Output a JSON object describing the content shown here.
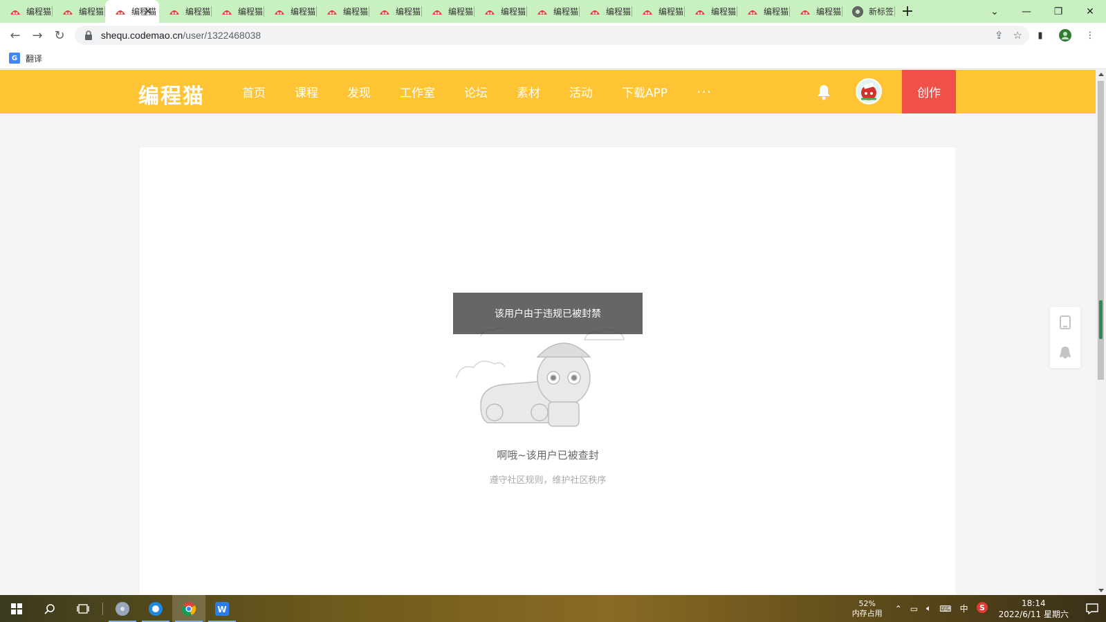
{
  "browser": {
    "tabs": [
      {
        "title": "编程猫",
        "active": false
      },
      {
        "title": "编程猫",
        "active": false
      },
      {
        "title": "编程猫",
        "active": true
      },
      {
        "title": "编程猫",
        "active": false
      },
      {
        "title": "编程猫",
        "active": false
      },
      {
        "title": "编程猫",
        "active": false
      },
      {
        "title": "编程猫",
        "active": false
      },
      {
        "title": "编程猫",
        "active": false
      },
      {
        "title": "编程猫",
        "active": false
      },
      {
        "title": "编程猫",
        "active": false
      },
      {
        "title": "编程猫",
        "active": false
      },
      {
        "title": "编程猫",
        "active": false
      },
      {
        "title": "编程猫",
        "active": false
      },
      {
        "title": "编程猫",
        "active": false
      },
      {
        "title": "编程猫",
        "active": false
      },
      {
        "title": "编程猫",
        "active": false
      },
      {
        "title": "新标签",
        "active": false
      }
    ],
    "url_host": "shequ.codemao.cn",
    "url_path": "/user/1322468038",
    "bookmark_label": "翻译"
  },
  "site": {
    "logo": "编程猫",
    "nav": [
      "首页",
      "课程",
      "发现",
      "工作室",
      "论坛",
      "素材",
      "活动",
      "下载APP"
    ],
    "nav_more": "···",
    "create_label": "创作"
  },
  "page": {
    "toast": "该用户由于违规已被封禁",
    "ban_title": "啊哦~该用户已被查封",
    "ban_sub": "遵守社区规则，维护社区秩序"
  },
  "taskbar": {
    "memory_percent": "52%",
    "memory_label": "内存占用",
    "ime": "中",
    "time": "18:14",
    "date": "2022/6/11 星期六"
  },
  "colors": {
    "header": "#fec433",
    "create_button": "#f0504a",
    "tabstrip": "#c9f0c1"
  }
}
